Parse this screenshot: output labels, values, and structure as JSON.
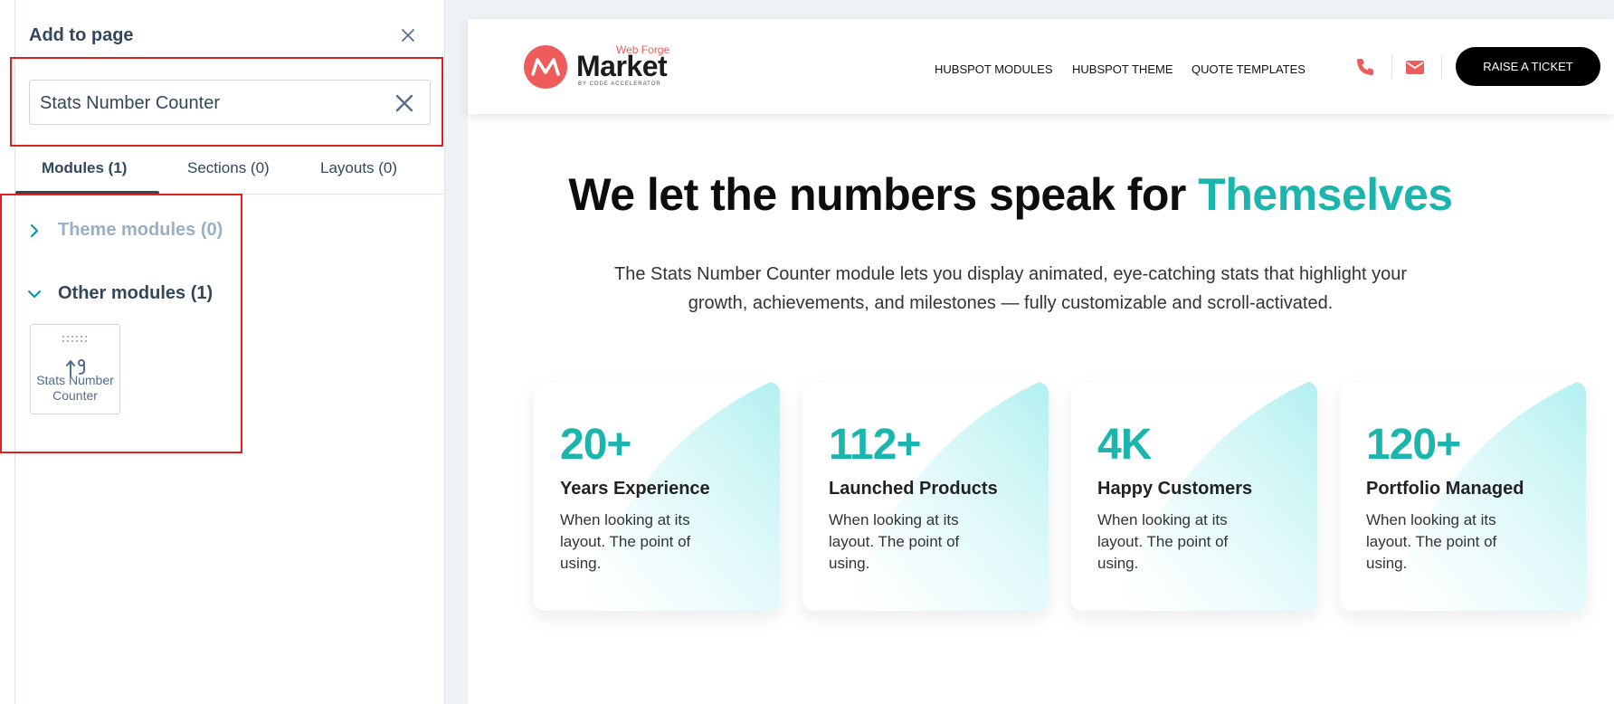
{
  "panel": {
    "title": "Add to page",
    "search_value": "Stats Number Counter",
    "tabs": [
      {
        "label": "Modules (1)"
      },
      {
        "label": "Sections (0)"
      },
      {
        "label": "Layouts (0)"
      }
    ],
    "groups": [
      {
        "label": "Theme modules (0)",
        "state": "collapsed"
      },
      {
        "label": "Other modules (1)",
        "state": "expanded"
      }
    ],
    "module": {
      "label": "Stats Number Counter",
      "icon": "counter-icon"
    }
  },
  "site": {
    "logo": {
      "top": "Web Forge",
      "name": "Market",
      "sub": "BY CODE ACCELERATOR"
    },
    "nav": [
      {
        "label": "HUBSPOT MODULES"
      },
      {
        "label": "HUBSPOT THEME"
      },
      {
        "label": "QUOTE TEMPLATES"
      }
    ],
    "ticket_button": "RAISE A TICKET",
    "icons": [
      "phone-icon",
      "email-icon"
    ]
  },
  "hero": {
    "title_main": "We let the numbers speak for",
    "title_accent": "Themselves",
    "description": "The Stats Number Counter module lets you display animated, eye-catching stats that highlight your growth, achievements, and milestones — fully customizable and scroll-activated."
  },
  "stats": [
    {
      "number": "20+",
      "title": "Years Experience",
      "desc": "When looking at its layout. The point of using."
    },
    {
      "number": "112+",
      "title": "Launched Products",
      "desc": "When looking at its layout. The point of using."
    },
    {
      "number": "4K",
      "title": "Happy Customers",
      "desc": "When looking at its layout. The point of using."
    },
    {
      "number": "120+",
      "title": "Portfolio Managed",
      "desc": "When looking at its layout. The point of using."
    }
  ],
  "colors": {
    "accent": "#1bb5ad",
    "brand_red": "#ee5b5b",
    "highlight_red": "#e01f1f",
    "panel_text": "#33475b"
  }
}
